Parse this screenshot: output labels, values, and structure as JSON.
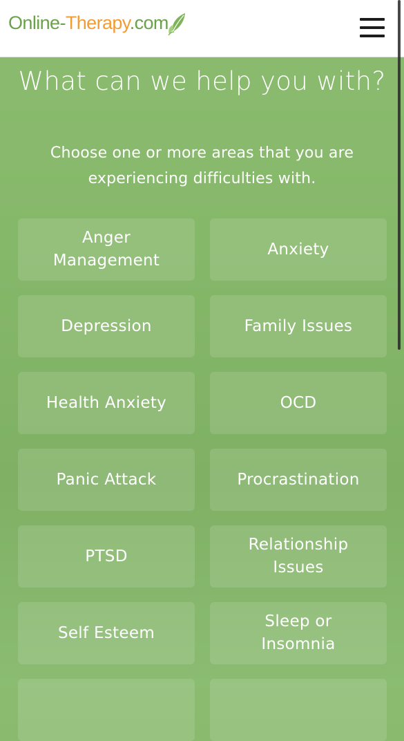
{
  "header": {
    "logo_part1": "Online-",
    "logo_part2": "Therapy",
    "logo_part3": ".com",
    "menu_icon": "hamburger-menu-icon",
    "brand_colors": {
      "green": "#6aa24a",
      "orange": "#f29c36"
    }
  },
  "main": {
    "title": "What can we help you with?",
    "subtitle": "Choose one or more areas that you are experiencing difficulties with.",
    "options": [
      {
        "label": "Anger Management"
      },
      {
        "label": "Anxiety"
      },
      {
        "label": "Depression"
      },
      {
        "label": "Family Issues"
      },
      {
        "label": "Health Anxiety"
      },
      {
        "label": "OCD"
      },
      {
        "label": "Panic Attack"
      },
      {
        "label": "Procrastination"
      },
      {
        "label": "PTSD"
      },
      {
        "label": "Relationship Issues"
      },
      {
        "label": "Self Esteem"
      },
      {
        "label": "Sleep or Insomnia"
      },
      {
        "label": ""
      },
      {
        "label": ""
      }
    ]
  }
}
